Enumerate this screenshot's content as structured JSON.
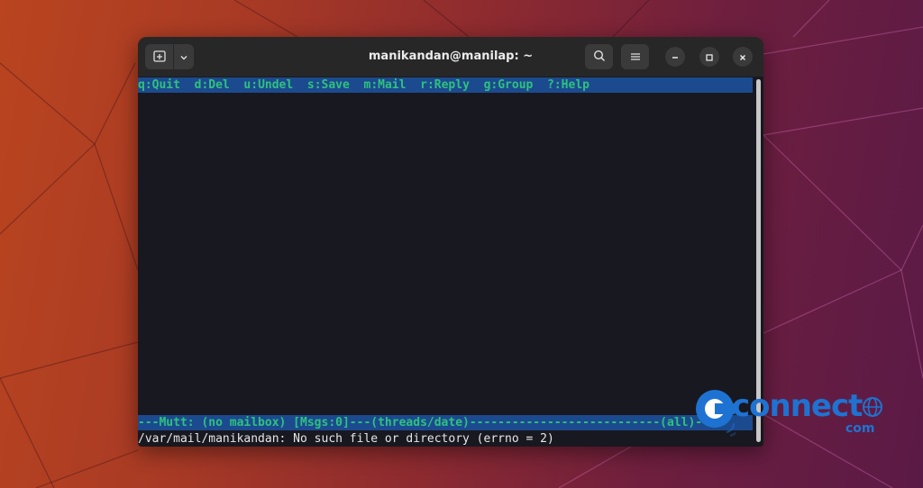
{
  "window": {
    "title": "manikandan@manilap: ~"
  },
  "titlebar": {
    "new_tab_icon": "new-tab-icon",
    "dropdown_icon": "chevron-down-icon",
    "search_icon": "search-icon",
    "menu_icon": "hamburger-menu-icon",
    "minimize_icon": "minimize-icon",
    "maximize_icon": "maximize-icon",
    "close_icon": "close-icon"
  },
  "terminal": {
    "help_items": [
      "q:Quit",
      "d:Del",
      "u:Undel",
      "s:Save",
      "m:Mail",
      "r:Reply",
      "g:Group",
      "?:Help"
    ],
    "status_line": "---Mutt: (no mailbox) [Msgs:0]---(threads/date)---------------------------(all)---",
    "message_line": "/var/mail/manikandan: No such file or directory (errno = 2)"
  },
  "watermark": {
    "brand": "connect",
    "suffix": "com"
  },
  "colors": {
    "help_bar_bg": "#1c4a8f",
    "help_text": "#2ec27e",
    "terminal_bg": "#181820",
    "titlebar_bg": "#272727",
    "brand_blue": "#1e73d2"
  }
}
